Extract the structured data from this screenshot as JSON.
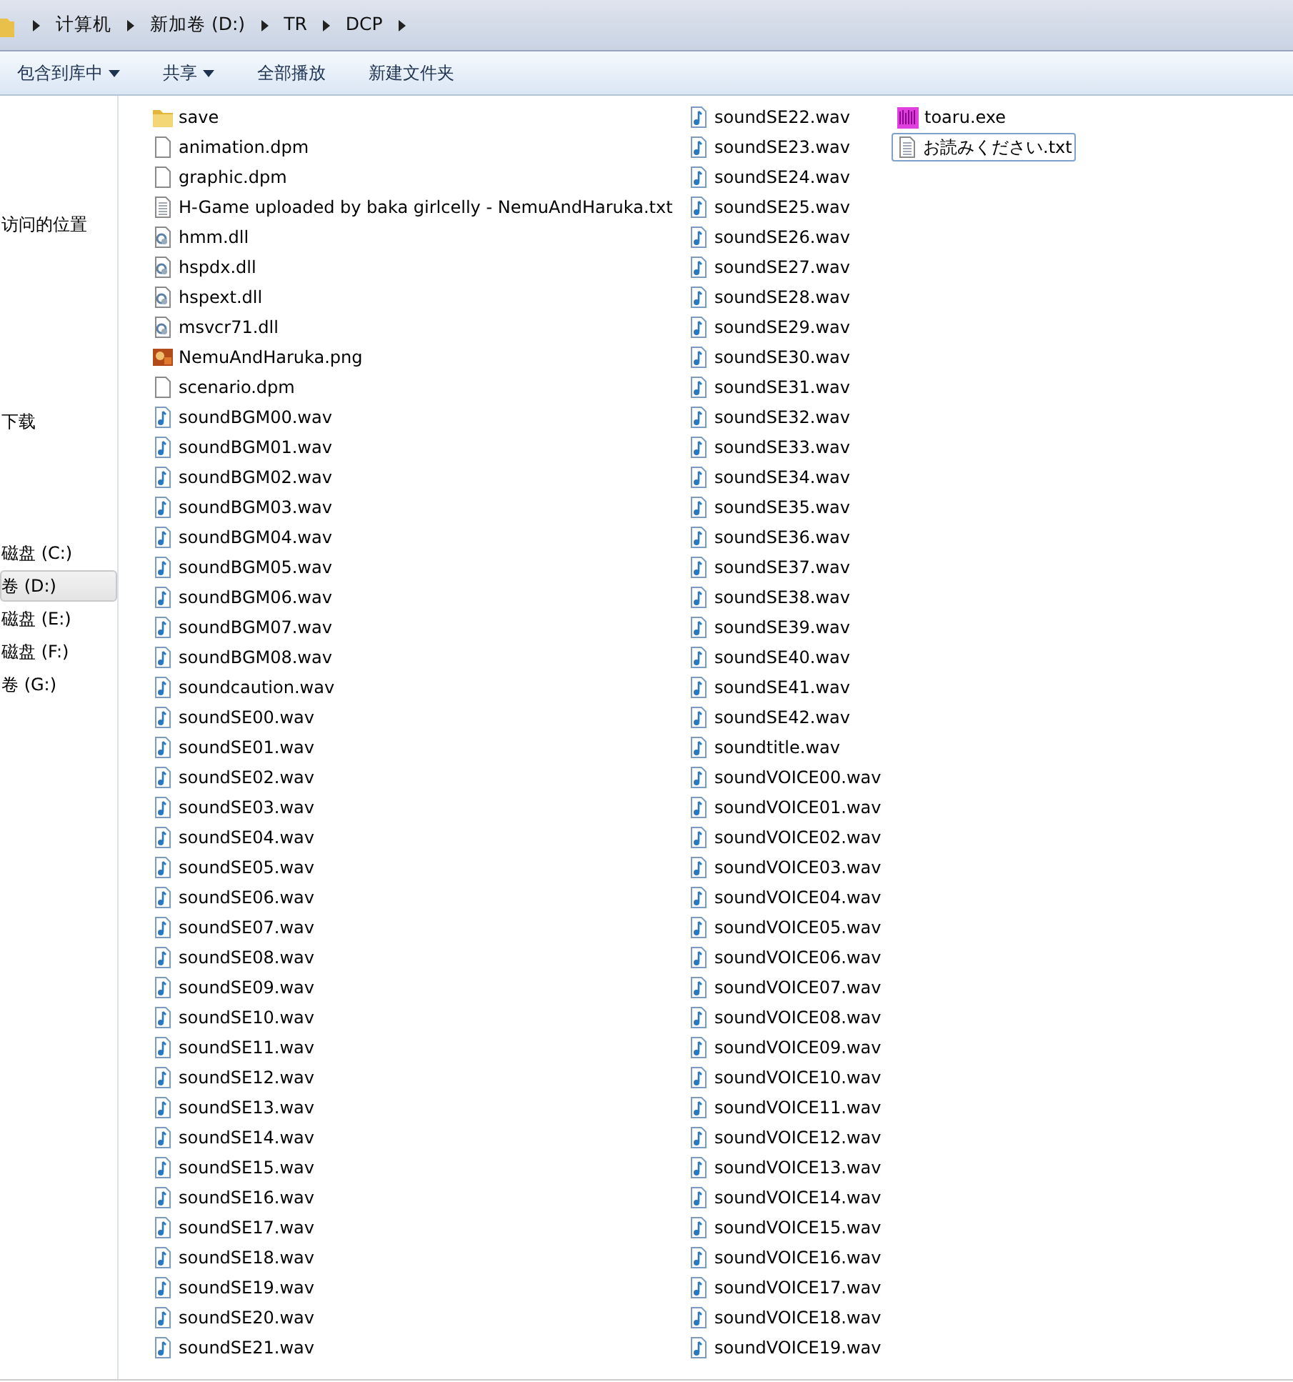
{
  "address_bar": {
    "crumbs": [
      "计算机",
      "新加卷 (D:)",
      "TR",
      "DCP"
    ]
  },
  "toolbar": [
    {
      "label": "包含到库中",
      "dropdown": true
    },
    {
      "label": "共享",
      "dropdown": true
    },
    {
      "label": "全部播放",
      "dropdown": false
    },
    {
      "label": "新建文件夹",
      "dropdown": false
    }
  ],
  "sidebar": {
    "items": [
      {
        "label": "访问的位置",
        "selected": false
      },
      {
        "label": "下载",
        "selected": false
      },
      {
        "label": "磁盘 (C:)",
        "selected": false
      },
      {
        "label": "卷 (D:)",
        "selected": true
      },
      {
        "label": "磁盘 (E:)",
        "selected": false
      },
      {
        "label": "磁盘 (F:)",
        "selected": false
      },
      {
        "label": "卷 (G:)",
        "selected": false
      }
    ]
  },
  "files": [
    {
      "name": "save",
      "kind": "folder",
      "selected": false
    },
    {
      "name": "animation.dpm",
      "kind": "file",
      "selected": false
    },
    {
      "name": "graphic.dpm",
      "kind": "file",
      "selected": false
    },
    {
      "name": "H-Game uploaded by baka girlcelly - NemuAndHaruka.txt",
      "kind": "text",
      "selected": false
    },
    {
      "name": "hmm.dll",
      "kind": "dll",
      "selected": false
    },
    {
      "name": "hspdx.dll",
      "kind": "dll",
      "selected": false
    },
    {
      "name": "hspext.dll",
      "kind": "dll",
      "selected": false
    },
    {
      "name": "msvcr71.dll",
      "kind": "dll",
      "selected": false
    },
    {
      "name": "NemuAndHaruka.png",
      "kind": "image",
      "selected": false
    },
    {
      "name": "scenario.dpm",
      "kind": "file",
      "selected": false
    },
    {
      "name": "soundBGM00.wav",
      "kind": "audio",
      "selected": false
    },
    {
      "name": "soundBGM01.wav",
      "kind": "audio",
      "selected": false
    },
    {
      "name": "soundBGM02.wav",
      "kind": "audio",
      "selected": false
    },
    {
      "name": "soundBGM03.wav",
      "kind": "audio",
      "selected": false
    },
    {
      "name": "soundBGM04.wav",
      "kind": "audio",
      "selected": false
    },
    {
      "name": "soundBGM05.wav",
      "kind": "audio",
      "selected": false
    },
    {
      "name": "soundBGM06.wav",
      "kind": "audio",
      "selected": false
    },
    {
      "name": "soundBGM07.wav",
      "kind": "audio",
      "selected": false
    },
    {
      "name": "soundBGM08.wav",
      "kind": "audio",
      "selected": false
    },
    {
      "name": "soundcaution.wav",
      "kind": "audio",
      "selected": false
    },
    {
      "name": "soundSE00.wav",
      "kind": "audio",
      "selected": false
    },
    {
      "name": "soundSE01.wav",
      "kind": "audio",
      "selected": false
    },
    {
      "name": "soundSE02.wav",
      "kind": "audio",
      "selected": false
    },
    {
      "name": "soundSE03.wav",
      "kind": "audio",
      "selected": false
    },
    {
      "name": "soundSE04.wav",
      "kind": "audio",
      "selected": false
    },
    {
      "name": "soundSE05.wav",
      "kind": "audio",
      "selected": false
    },
    {
      "name": "soundSE06.wav",
      "kind": "audio",
      "selected": false
    },
    {
      "name": "soundSE07.wav",
      "kind": "audio",
      "selected": false
    },
    {
      "name": "soundSE08.wav",
      "kind": "audio",
      "selected": false
    },
    {
      "name": "soundSE09.wav",
      "kind": "audio",
      "selected": false
    },
    {
      "name": "soundSE10.wav",
      "kind": "audio",
      "selected": false
    },
    {
      "name": "soundSE11.wav",
      "kind": "audio",
      "selected": false
    },
    {
      "name": "soundSE12.wav",
      "kind": "audio",
      "selected": false
    },
    {
      "name": "soundSE13.wav",
      "kind": "audio",
      "selected": false
    },
    {
      "name": "soundSE14.wav",
      "kind": "audio",
      "selected": false
    },
    {
      "name": "soundSE15.wav",
      "kind": "audio",
      "selected": false
    },
    {
      "name": "soundSE16.wav",
      "kind": "audio",
      "selected": false
    },
    {
      "name": "soundSE17.wav",
      "kind": "audio",
      "selected": false
    },
    {
      "name": "soundSE18.wav",
      "kind": "audio",
      "selected": false
    },
    {
      "name": "soundSE19.wav",
      "kind": "audio",
      "selected": false
    },
    {
      "name": "soundSE20.wav",
      "kind": "audio",
      "selected": false
    },
    {
      "name": "soundSE21.wav",
      "kind": "audio",
      "selected": false
    },
    {
      "name": "soundSE22.wav",
      "kind": "audio",
      "selected": false
    },
    {
      "name": "soundSE23.wav",
      "kind": "audio",
      "selected": false
    },
    {
      "name": "soundSE24.wav",
      "kind": "audio",
      "selected": false
    },
    {
      "name": "soundSE25.wav",
      "kind": "audio",
      "selected": false
    },
    {
      "name": "soundSE26.wav",
      "kind": "audio",
      "selected": false
    },
    {
      "name": "soundSE27.wav",
      "kind": "audio",
      "selected": false
    },
    {
      "name": "soundSE28.wav",
      "kind": "audio",
      "selected": false
    },
    {
      "name": "soundSE29.wav",
      "kind": "audio",
      "selected": false
    },
    {
      "name": "soundSE30.wav",
      "kind": "audio",
      "selected": false
    },
    {
      "name": "soundSE31.wav",
      "kind": "audio",
      "selected": false
    },
    {
      "name": "soundSE32.wav",
      "kind": "audio",
      "selected": false
    },
    {
      "name": "soundSE33.wav",
      "kind": "audio",
      "selected": false
    },
    {
      "name": "soundSE34.wav",
      "kind": "audio",
      "selected": false
    },
    {
      "name": "soundSE35.wav",
      "kind": "audio",
      "selected": false
    },
    {
      "name": "soundSE36.wav",
      "kind": "audio",
      "selected": false
    },
    {
      "name": "soundSE37.wav",
      "kind": "audio",
      "selected": false
    },
    {
      "name": "soundSE38.wav",
      "kind": "audio",
      "selected": false
    },
    {
      "name": "soundSE39.wav",
      "kind": "audio",
      "selected": false
    },
    {
      "name": "soundSE40.wav",
      "kind": "audio",
      "selected": false
    },
    {
      "name": "soundSE41.wav",
      "kind": "audio",
      "selected": false
    },
    {
      "name": "soundSE42.wav",
      "kind": "audio",
      "selected": false
    },
    {
      "name": "soundtitle.wav",
      "kind": "audio",
      "selected": false
    },
    {
      "name": "soundVOICE00.wav",
      "kind": "audio",
      "selected": false
    },
    {
      "name": "soundVOICE01.wav",
      "kind": "audio",
      "selected": false
    },
    {
      "name": "soundVOICE02.wav",
      "kind": "audio",
      "selected": false
    },
    {
      "name": "soundVOICE03.wav",
      "kind": "audio",
      "selected": false
    },
    {
      "name": "soundVOICE04.wav",
      "kind": "audio",
      "selected": false
    },
    {
      "name": "soundVOICE05.wav",
      "kind": "audio",
      "selected": false
    },
    {
      "name": "soundVOICE06.wav",
      "kind": "audio",
      "selected": false
    },
    {
      "name": "soundVOICE07.wav",
      "kind": "audio",
      "selected": false
    },
    {
      "name": "soundVOICE08.wav",
      "kind": "audio",
      "selected": false
    },
    {
      "name": "soundVOICE09.wav",
      "kind": "audio",
      "selected": false
    },
    {
      "name": "soundVOICE10.wav",
      "kind": "audio",
      "selected": false
    },
    {
      "name": "soundVOICE11.wav",
      "kind": "audio",
      "selected": false
    },
    {
      "name": "soundVOICE12.wav",
      "kind": "audio",
      "selected": false
    },
    {
      "name": "soundVOICE13.wav",
      "kind": "audio",
      "selected": false
    },
    {
      "name": "soundVOICE14.wav",
      "kind": "audio",
      "selected": false
    },
    {
      "name": "soundVOICE15.wav",
      "kind": "audio",
      "selected": false
    },
    {
      "name": "soundVOICE16.wav",
      "kind": "audio",
      "selected": false
    },
    {
      "name": "soundVOICE17.wav",
      "kind": "audio",
      "selected": false
    },
    {
      "name": "soundVOICE18.wav",
      "kind": "audio",
      "selected": false
    },
    {
      "name": "soundVOICE19.wav",
      "kind": "audio",
      "selected": false
    },
    {
      "name": "toaru.exe",
      "kind": "exe",
      "selected": false
    },
    {
      "name": "お読みください.txt",
      "kind": "text",
      "selected": true
    }
  ]
}
